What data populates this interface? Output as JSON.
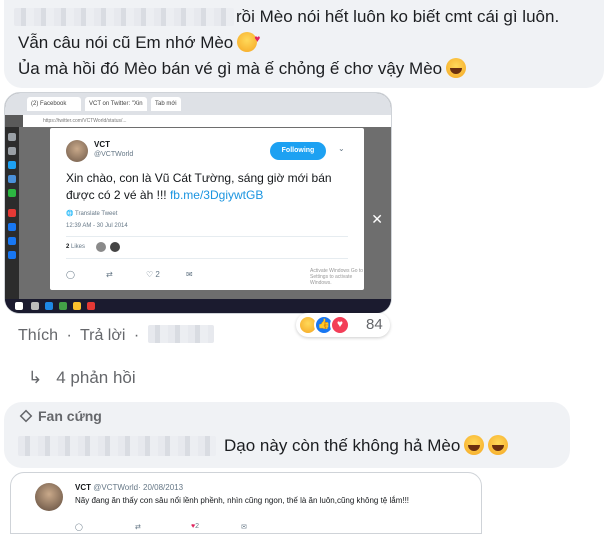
{
  "comment1": {
    "line1": "rồi Mèo nói hết luôn ko biết cmt cái gì luôn.",
    "line2": "Vẫn câu nói cũ Em nhớ Mèo",
    "line3": "Ủa mà hồi đó Mèo bán vé gì mà ế chỏng ế chơ vậy Mèo"
  },
  "screenshot": {
    "tabs": [
      "(2) Facebook",
      "VCT on Twitter: \"Xin chà",
      "Tab mới"
    ],
    "address": "https://twitter.com/VCTWorld/status/...",
    "tweet": {
      "name": "VCT",
      "handle": "@VCTWorld",
      "follow_label": "Following",
      "text": "Xin chào, con là Vũ Cát Tường, sáng giờ mới bán được có 2 vé àh !!! ",
      "link": "fb.me/3DgiywtGB",
      "translate": "Translate Tweet",
      "datetime": "12:39 AM - 30 Jul 2014",
      "likes_count": "2",
      "likes_label": "Likes",
      "heart_count": "2",
      "watermark": "Activate Windows Go to Settings to activate Windows."
    }
  },
  "actions": {
    "like": "Thích",
    "dot": "·",
    "reply": "Trả lời",
    "dot2": "·",
    "reaction_count": "84"
  },
  "replies": {
    "label": "4 phản hồi"
  },
  "comment2": {
    "badge": "Fan cứng",
    "text": "Dạo này còn thế không hả Mèo"
  },
  "tweet2": {
    "name": "VCT",
    "handle": "@VCTWorld",
    "date": "· 20/08/2013",
    "text": "Nãy đang ăn thấy con sâu nổi lềnh phềnh, nhìn cũng ngon, thế là ăn luôn,cũng không tệ lắm!!!",
    "heart_count": "2"
  },
  "colors": {
    "bubble": "#f0f2f5",
    "twitter_blue": "#1da1f2",
    "link_blue": "#1b95e0",
    "fb_gray": "#65676b"
  },
  "icons": [
    "laughing-emoji-icon",
    "kiss-emoji-icon",
    "reply-arrow-icon",
    "diamond-icon",
    "haha-reaction-icon",
    "like-reaction-icon",
    "love-reaction-icon"
  ]
}
